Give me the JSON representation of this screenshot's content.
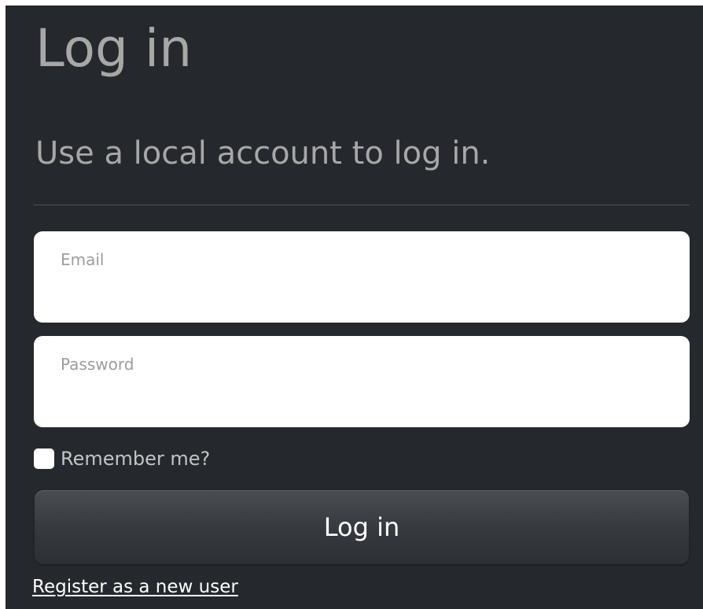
{
  "page": {
    "title": "Log in",
    "subtitle": "Use a local account to log in."
  },
  "form": {
    "email": {
      "label": "Email",
      "value": ""
    },
    "password": {
      "label": "Password",
      "value": ""
    },
    "remember": {
      "label": "Remember me?",
      "checked": false
    },
    "submit_label": "Log in",
    "register_link": "Register as a new user"
  },
  "colors": {
    "panel_background": "#25282d",
    "heading_text": "#a7a7a7",
    "input_background": "#ffffff",
    "placeholder_text": "#9c9c9c",
    "button_text": "#ffffff"
  }
}
